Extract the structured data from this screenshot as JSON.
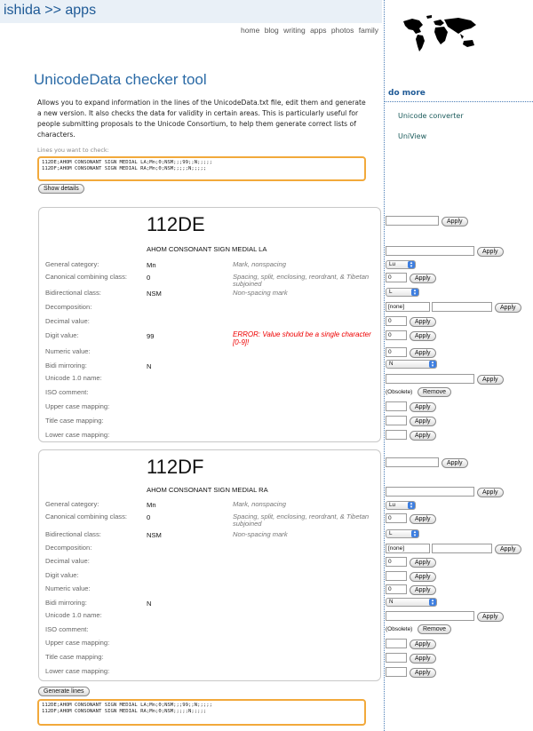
{
  "site": {
    "brand": "ishida >> apps",
    "nav": [
      "home",
      "blog",
      "writing",
      "apps",
      "photos",
      "family"
    ]
  },
  "page": {
    "title": "UnicodeData checker tool",
    "intro": "Allows you to expand information in the lines of the UnicodeData.txt file, edit them and generate a new version. It also checks the data for validity in certain areas. This is particularly useful for people submitting proposals to the Unicode Consortium, to help them generate correct lists of characters.",
    "lines_label": "Lines you want to check:",
    "input_text": "112DE;AHOM CONSONANT SIGN MEDIAL LA;Mn;0;NSM;;;99;;N;;;;;\n112DF;AHOM CONSONANT SIGN MEDIAL RA;Mn;0;NSM;;;;;N;;;;;",
    "show_details": "Show details",
    "generate_lines": "Generate lines",
    "output_text": "112DE;AHOM CONSONANT SIGN MEDIAL LA;Mn;0;NSM;;;99;;N;;;;;\n112DF;AHOM CONSONANT SIGN MEDIAL RA;Mn;0;NSM;;;;;N;;;;;"
  },
  "sidebar": {
    "heading": "do more",
    "links": [
      "Unicode converter",
      "UniView"
    ]
  },
  "labels": {
    "general_category": "General category:",
    "canonical_combining": "Canonical combining class:",
    "bidi_class": "Bidirectional class:",
    "decomposition": "Decomposition:",
    "decimal_value": "Decimal value:",
    "digit_value": "Digit value:",
    "numeric_value": "Numeric value:",
    "bidi_mirroring": "Bidi mirroring:",
    "unicode1_name": "Unicode 1.0 name:",
    "iso_comment": "ISO comment:",
    "upper_case": "Upper case mapping:",
    "title_case": "Title case mapping:",
    "lower_case": "Lower case mapping:",
    "apply": "Apply",
    "remove": "Remove",
    "obsolete": "(Obsolete)"
  },
  "entries": [
    {
      "code": "112DE",
      "name": "AHOM CONSONANT SIGN MEDIAL LA",
      "general_category": "Mn",
      "general_category_desc": "Mark, nonspacing",
      "ccc": "0",
      "ccc_desc": "Spacing, split, enclosing, reordrant, & Tibetan subjoined",
      "bidi": "NSM",
      "bidi_desc": "Non-spacing mark",
      "digit": "99",
      "digit_error": "ERROR: Value should be a single character [0-9]!",
      "mirroring": "N",
      "ctrl_gc": "Lu",
      "ctrl_ccc": "0",
      "ctrl_bidi": "L",
      "ctrl_decomp": "[none]",
      "ctrl_decimal": "0",
      "ctrl_digit": "0",
      "ctrl_numeric": "0",
      "ctrl_mirror": "N"
    },
    {
      "code": "112DF",
      "name": "AHOM CONSONANT SIGN MEDIAL RA",
      "general_category": "Mn",
      "general_category_desc": "Mark, nonspacing",
      "ccc": "0",
      "ccc_desc": "Spacing, split, enclosing, reordrant, & Tibetan subjoined",
      "bidi": "NSM",
      "bidi_desc": "Non-spacing mark",
      "digit": "",
      "digit_error": "",
      "mirroring": "N",
      "ctrl_gc": "Lu",
      "ctrl_ccc": "0",
      "ctrl_bidi": "L",
      "ctrl_decomp": "[none]",
      "ctrl_decimal": "0",
      "ctrl_digit": "",
      "ctrl_numeric": "0",
      "ctrl_mirror": "N"
    }
  ]
}
